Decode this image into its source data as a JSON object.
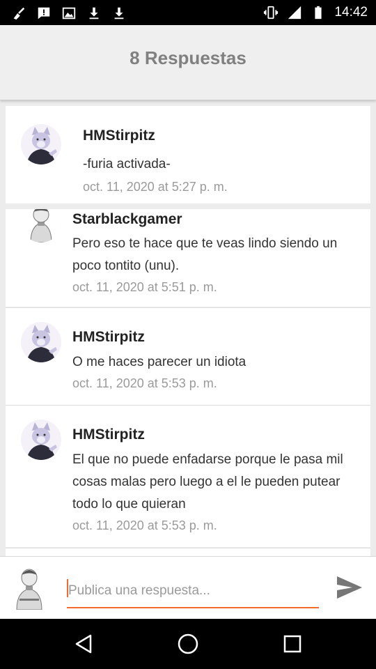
{
  "status_bar": {
    "time": "14:42",
    "left_icons": [
      "broom-icon",
      "message-icon",
      "image-icon",
      "download-icon",
      "download-icon"
    ],
    "right_icons": [
      "vibrate-icon",
      "signal-icon",
      "battery-icon"
    ]
  },
  "header": {
    "title": "8 Respuestas"
  },
  "comments": [
    {
      "author": "HMStirpitz",
      "text": "-furia activada-",
      "date": "oct. 11, 2020 at 5:27 p. m.",
      "avatar": "wolf-avatar"
    },
    {
      "author": "Starblackgamer",
      "text": "Pero eso te hace que te veas lindo siendo un poco tontito (unu).",
      "date": "oct. 11, 2020 at 5:51 p. m.",
      "avatar": "character-avatar"
    },
    {
      "author": "HMStirpitz",
      "text": "O me haces parecer un idiota",
      "date": "oct. 11, 2020 at 5:53 p. m.",
      "avatar": "wolf-avatar"
    },
    {
      "author": "HMStirpitz",
      "text": "El que no puede enfadarse porque le pasa mil cosas malas pero luego a el le pueden putear todo lo que quieran",
      "date": "oct. 11, 2020 at 5:53 p. m.",
      "avatar": "wolf-avatar"
    }
  ],
  "reply": {
    "placeholder": "Publica una respuesta..."
  },
  "colors": {
    "accent": "#f26b2d",
    "date_gray": "#9a9a9a",
    "header_gray": "#808080"
  }
}
